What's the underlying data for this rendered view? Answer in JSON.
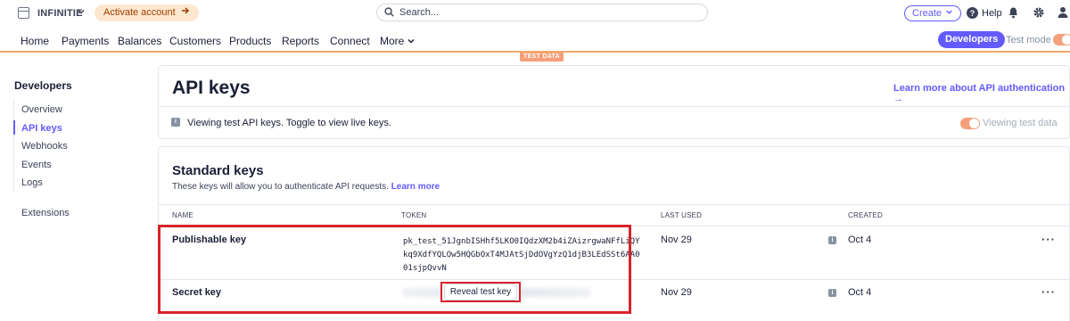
{
  "topbar": {
    "account_name": "INFINITIE",
    "activate_label": "Activate account",
    "search_placeholder": "Search...",
    "create_label": "Create",
    "help_label": "Help"
  },
  "nav": {
    "items": [
      "Home",
      "Payments",
      "Balances",
      "Customers",
      "Products",
      "Reports",
      "Connect",
      "More"
    ],
    "developers_label": "Developers",
    "test_mode_label": "Test mode",
    "test_data_badge": "TEST DATA"
  },
  "sidebar": {
    "title": "Developers",
    "items": [
      "Overview",
      "API keys",
      "Webhooks",
      "Events",
      "Logs",
      "Extensions"
    ],
    "active_item": "API keys"
  },
  "header": {
    "title": "API keys",
    "learn_more_link": "Learn more about API authentication →",
    "notice": "Viewing test API keys. Toggle to view live keys.",
    "viewing_test_data": "Viewing test data"
  },
  "standard_keys": {
    "title": "Standard keys",
    "description": "These keys will allow you to authenticate API requests.",
    "learn_more": "Learn more",
    "columns": [
      "NAME",
      "TOKEN",
      "LAST USED",
      "CREATED"
    ],
    "rows": [
      {
        "name": "Publishable key",
        "token": "pk_test_51JgnbISHhf5LKO0IQdzXM2b4iZAizrgwaNFfLiQYkq9XdfYQLOw5HQGbOxT4MJAtSjDdOVgYzQ1djB3LEdSSt6AA001sjpQvvN",
        "last_used": "Nov 29",
        "created": "Oct 4"
      },
      {
        "name": "Secret key",
        "reveal_label": "Reveal test key",
        "last_used": "Nov 29",
        "created": "Oct 4"
      }
    ]
  },
  "colors": {
    "accent": "#635bff",
    "test_orange": "#f5a07a",
    "highlight_red": "#d8232a"
  },
  "icons": [
    "account-logo-icon",
    "chevron-down-icon",
    "arrow-right-icon",
    "search-icon",
    "help-icon",
    "bell-icon",
    "gear-icon",
    "user-icon",
    "info-icon",
    "more-icon"
  ]
}
